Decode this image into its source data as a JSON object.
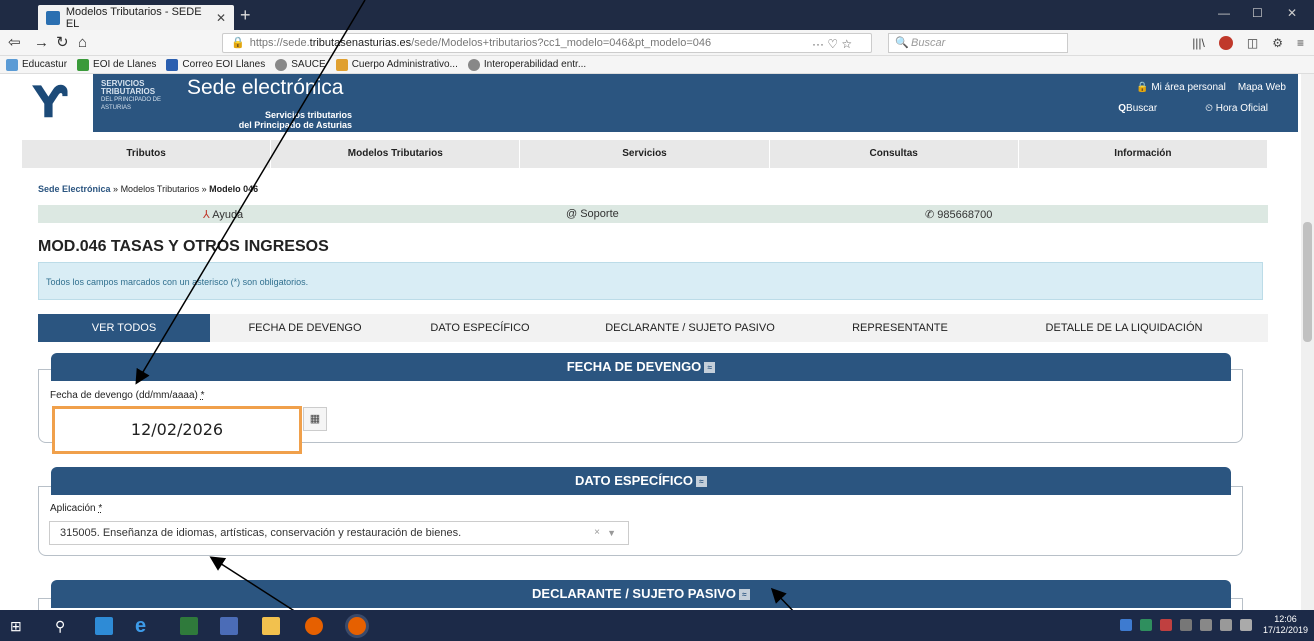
{
  "browser": {
    "tab_title": "Modelos Tributarios - SEDE EL",
    "url_prefix": "https://sede.",
    "url_host": "tributasenasturias.es",
    "url_rest": "/sede/Modelos+tributarios?cc1_modelo=046&pt_modelo=046",
    "search_placeholder": "Buscar",
    "bookmarks": [
      "Educastur",
      "EOI de Llanes",
      "Correo EOI Llanes",
      "SAUCE",
      "Cuerpo Administrativo...",
      "Interoperabilidad entr..."
    ]
  },
  "header": {
    "logo_line1": "SERVICIOS",
    "logo_line2": "TRIBUTARIOS",
    "logo_line3": "DEL PRINCIPADO DE ASTURIAS",
    "title": "Sede electrónica",
    "subtitle_line1": "Servicios tributarios",
    "subtitle_line2": "del Principado de Asturias",
    "area_personal": "Mi área personal",
    "mapa_web": "Mapa Web",
    "buscar": "Buscar",
    "hora_oficial": "Hora Oficial"
  },
  "menu": [
    "Tributos",
    "Modelos Tributarios",
    "Servicios",
    "Consultas",
    "Información"
  ],
  "breadcrumb": {
    "root": "Sede Electrónica",
    "sep": " » ",
    "mid": "Modelos Tributarios",
    "current": "Modelo 046"
  },
  "helpbar": {
    "ayuda": "Ayuda",
    "soporte": "@ Soporte",
    "telefono": "✆ 985668700"
  },
  "page_title": "MOD.046 TASAS Y OTROS INGRESOS",
  "info_text": "Todos los campos marcados con un asterisco (*) son obligatorios.",
  "tabs": [
    "VER TODOS",
    "FECHA DE DEVENGO",
    "DATO ESPECÍFICO",
    "DECLARANTE / SUJETO PASIVO",
    "REPRESENTANTE",
    "DETALLE DE LA LIQUIDACIÓN"
  ],
  "sections": {
    "fecha": {
      "title": "FECHA DE DEVENGO",
      "label": "Fecha de devengo (dd/mm/aaaa)",
      "required": "*",
      "value": "12/02/2026"
    },
    "dato": {
      "title": "DATO ESPECÍFICO",
      "label": "Aplicación",
      "required": "*",
      "value": "315005. Enseñanza de idiomas, artísticas, conservación y restauración de bienes."
    },
    "declarante": {
      "title": "DECLARANTE / SUJETO PASIVO"
    }
  },
  "clock": {
    "time": "12:06",
    "date": "17/12/2019"
  },
  "colors": {
    "brand": "#2b5580",
    "highlight": "#f0a04b",
    "info_bg": "#d9edf5"
  }
}
